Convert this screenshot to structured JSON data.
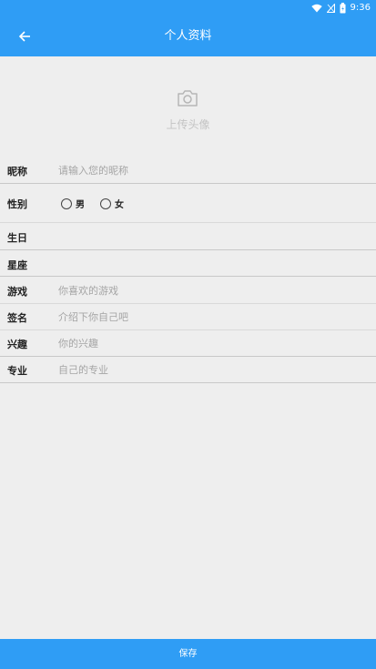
{
  "status_bar": {
    "time": "9:36",
    "icons": [
      "wifi-icon",
      "signal-icon",
      "battery-icon"
    ]
  },
  "toolbar": {
    "back_icon": "arrow-left-icon",
    "title": "个人资料"
  },
  "avatar": {
    "icon": "camera-icon",
    "upload_label": "上传头像"
  },
  "form": {
    "nickname": {
      "label": "昵称",
      "value": "",
      "placeholder": "请输入您的昵称"
    },
    "gender": {
      "label": "性别",
      "options": [
        {
          "label": "男",
          "checked": false
        },
        {
          "label": "女",
          "checked": false
        }
      ]
    },
    "birthday": {
      "label": "生日",
      "value": ""
    },
    "constellation": {
      "label": "星座",
      "value": ""
    },
    "game": {
      "label": "游戏",
      "value": "",
      "placeholder": "你喜欢的游戏"
    },
    "signature": {
      "label": "签名",
      "value": "",
      "placeholder": "介绍下你自己吧"
    },
    "interest": {
      "label": "兴趣",
      "value": "",
      "placeholder": "你的兴趣"
    },
    "major": {
      "label": "专业",
      "value": "",
      "placeholder": "自己的专业"
    }
  },
  "save_button": {
    "label": "保存"
  },
  "colors": {
    "primary": "#2f9df5",
    "background": "#eeeeee",
    "placeholder": "#a5a5a5",
    "divider": "#c8c8c8"
  }
}
